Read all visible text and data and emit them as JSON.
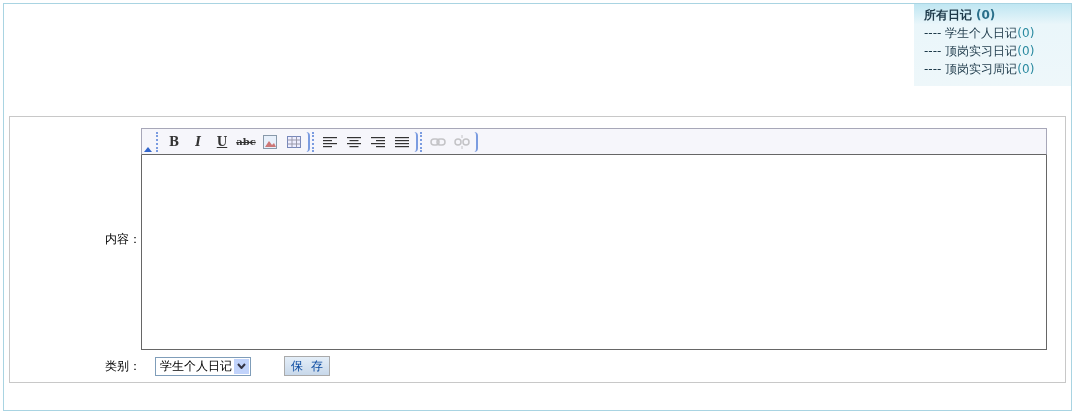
{
  "diary_menu": {
    "title": {
      "label": "所有日记",
      "count": "(0)"
    },
    "items": [
      {
        "prefix": "----",
        "label": "学生个人日记",
        "count": "(0)"
      },
      {
        "prefix": "----",
        "label": "顶岗实习日记",
        "count": "(0)"
      },
      {
        "prefix": "----",
        "label": "顶岗实习周记",
        "count": "(0)"
      }
    ]
  },
  "form": {
    "content_label": "内容：",
    "toolbar": [
      [
        {
          "kind": "bold",
          "label": "B",
          "disabled": false
        },
        {
          "kind": "italic",
          "label": "I",
          "disabled": false
        },
        {
          "kind": "underline",
          "label": "U",
          "disabled": false
        },
        {
          "kind": "strike",
          "label": "abc",
          "disabled": false
        },
        {
          "kind": "image",
          "disabled": false
        },
        {
          "kind": "table",
          "disabled": false
        }
      ],
      [
        {
          "kind": "align-left",
          "disabled": false
        },
        {
          "kind": "align-center",
          "disabled": false
        },
        {
          "kind": "align-right",
          "disabled": false
        },
        {
          "kind": "justify",
          "disabled": false
        }
      ],
      [
        {
          "kind": "link",
          "disabled": true
        },
        {
          "kind": "unlink",
          "disabled": true
        }
      ]
    ],
    "category_label": "类别：",
    "category_value": "学生个人日记",
    "save_button": "保  存"
  }
}
